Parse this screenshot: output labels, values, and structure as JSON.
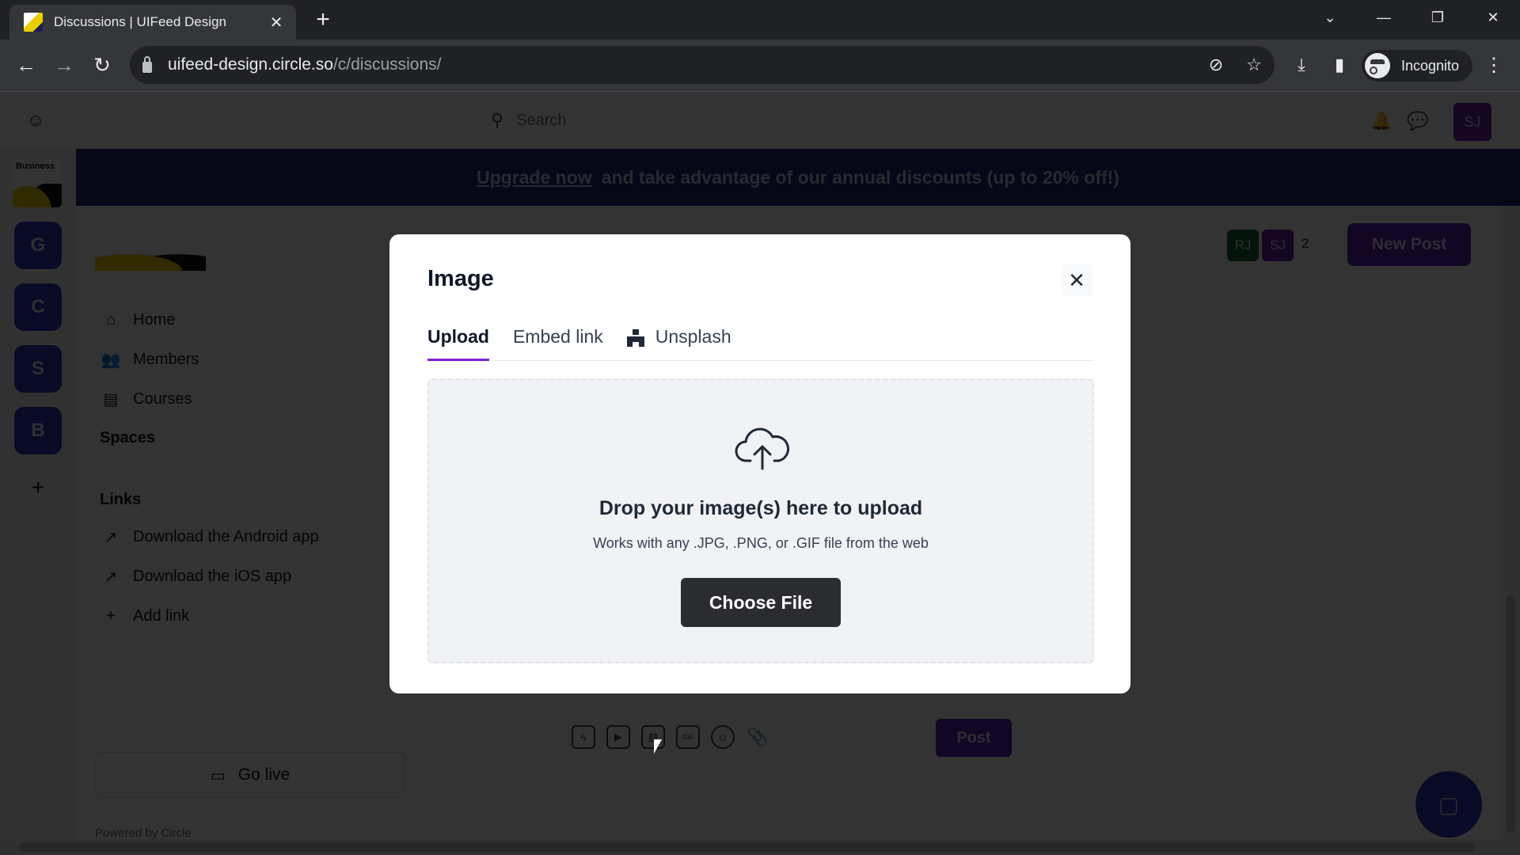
{
  "browser": {
    "tab_title": "Discussions | UIFeed Design",
    "tab_close": "✕",
    "new_tab": "+",
    "url_host": "uifeed-design.circle.so",
    "url_path": "/c/discussions/",
    "profile_label": "Incognito",
    "window_controls": {
      "tab_search": "⌄",
      "minimize": "—",
      "restore": "❐",
      "close": "✕"
    },
    "nav": {
      "back": "←",
      "forward": "→",
      "reload": "↻"
    },
    "icons": {
      "eye_off": "⊘",
      "star": "☆",
      "download": "⤓",
      "sidepanel": "▮",
      "menu": "⋮"
    }
  },
  "header": {
    "search_placeholder": "Search",
    "avatar_initials": "SJ",
    "icons": {
      "community": "☺",
      "search": "⚲",
      "bell": "🔔",
      "chat": "💬"
    }
  },
  "banner": {
    "link": "Upgrade now",
    "text": "and take advantage of our annual discounts (up to 20% off!)"
  },
  "rail": {
    "business_label": "Business",
    "tiles": [
      "G",
      "C",
      "S",
      "B"
    ],
    "add": "+"
  },
  "sidebar": {
    "nav": [
      {
        "label": "Home",
        "icon": "⌂"
      },
      {
        "label": "Members",
        "icon": "👥"
      },
      {
        "label": "Courses",
        "icon": "▤"
      }
    ],
    "spaces_title": "Spaces",
    "links_title": "Links",
    "links": [
      {
        "label": "Download the Android app",
        "icon": "↗"
      },
      {
        "label": "Download the iOS app",
        "icon": "↗"
      },
      {
        "label": "Add link",
        "icon": "+"
      }
    ],
    "go_live": "Go live",
    "go_live_icon": "▭",
    "powered_by": "Powered by Circle"
  },
  "feed": {
    "members": [
      "RJ",
      "SJ"
    ],
    "member_count": "2",
    "new_post": "New Post",
    "post": "Post",
    "composer_tools": [
      {
        "name": "lightning",
        "glyph": "ϟ"
      },
      {
        "name": "video",
        "glyph": "▶"
      },
      {
        "name": "image",
        "glyph": "▨"
      },
      {
        "name": "gif",
        "glyph": "GIF"
      },
      {
        "name": "emoji",
        "glyph": "☺"
      },
      {
        "name": "attachment",
        "glyph": "📎"
      }
    ],
    "chat_icon": "▢"
  },
  "modal": {
    "title": "Image",
    "close": "✕",
    "tabs": [
      {
        "label": "Upload",
        "active": true
      },
      {
        "label": "Embed link",
        "active": false
      },
      {
        "label": "Unsplash",
        "active": false
      }
    ],
    "drop_title": "Drop your image(s) here to upload",
    "drop_subtitle": "Works with any .JPG, .PNG, or .GIF file from the web",
    "choose_file": "Choose File"
  },
  "colors": {
    "accent_purple": "#7e22ce",
    "brand_blue": "#2f3bbf",
    "button_dark": "#2a2c30"
  }
}
